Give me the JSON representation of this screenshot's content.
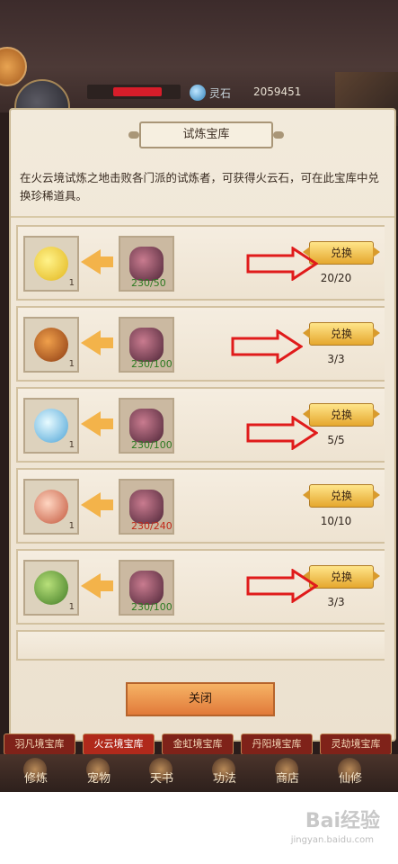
{
  "hud": {
    "currency_label": "灵石",
    "currency_value": "2059451"
  },
  "panel": {
    "title": "试炼宝库",
    "description": "在火云境试炼之地击败各门派的试炼者，可获得火云石，可在此宝库中兑换珍稀道具。",
    "rows": [
      {
        "reward_qty": "1",
        "cost_qty": "230/50",
        "cost_ok": true,
        "button": "兑换",
        "count": "20/20",
        "reward_color": "#f0d53a"
      },
      {
        "reward_qty": "1",
        "cost_qty": "230/100",
        "cost_ok": true,
        "button": "兑换",
        "count": "3/3",
        "reward_color": "#c86a2b"
      },
      {
        "reward_qty": "1",
        "cost_qty": "230/100",
        "cost_ok": true,
        "button": "兑换",
        "count": "5/5",
        "reward_color": "#89c9e8"
      },
      {
        "reward_qty": "1",
        "cost_qty": "230/240",
        "cost_ok": false,
        "button": "兑换",
        "count": "10/10",
        "reward_color": "#e1916e"
      },
      {
        "reward_qty": "1",
        "cost_qty": "230/100",
        "cost_ok": true,
        "button": "兑换",
        "count": "3/3",
        "reward_color": "#6da63a"
      }
    ],
    "close_label": "关闭"
  },
  "tabs": [
    "羽凡境宝库",
    "火云境宝库",
    "金虹境宝库",
    "丹阳境宝库",
    "灵劫境宝库"
  ],
  "nav": [
    "修炼",
    "宠物",
    "天书",
    "功法",
    "商店",
    "仙修"
  ],
  "watermark": {
    "title": "Bai经验",
    "url": "jingyan.baidu.com"
  },
  "colors": {
    "accent": "#e5a72e",
    "danger": "#c22a1a",
    "ok": "#2d7a22"
  }
}
